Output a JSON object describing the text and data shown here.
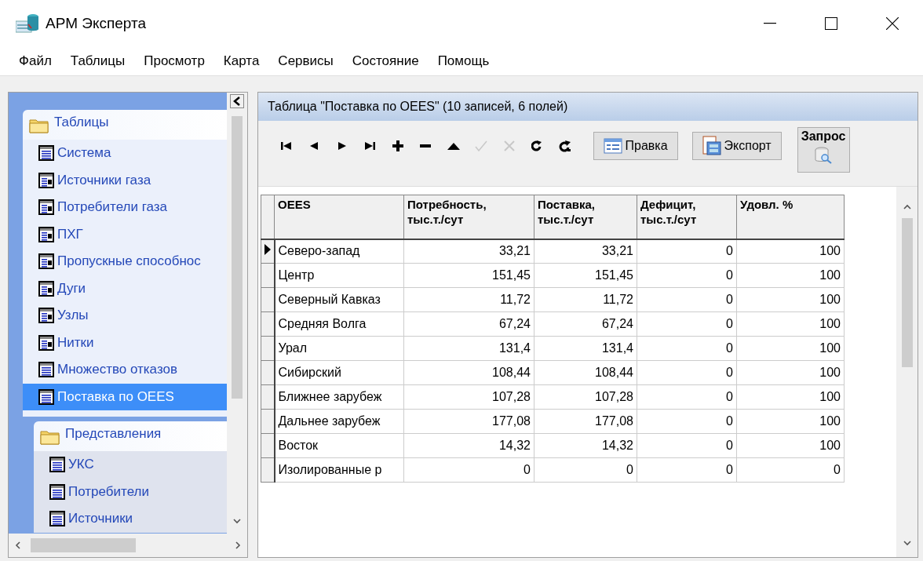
{
  "window": {
    "title": "АРМ Эксперта"
  },
  "menu": [
    "Файл",
    "Таблицы",
    "Просмотр",
    "Карта",
    "Сервисы",
    "Состояние",
    "Помощь"
  ],
  "sidebar": {
    "groups": [
      {
        "title": "Таблицы",
        "items": [
          {
            "label": "Система",
            "selected": false
          },
          {
            "label": "Источники газа",
            "selected": false
          },
          {
            "label": "Потребители газа",
            "selected": false
          },
          {
            "label": "ПХГ",
            "selected": false
          },
          {
            "label": "Пропускные способнос",
            "selected": false
          },
          {
            "label": "Дуги",
            "selected": false
          },
          {
            "label": "Узлы",
            "selected": false
          },
          {
            "label": "Нитки",
            "selected": false
          },
          {
            "label": "Множество отказов",
            "selected": false
          },
          {
            "label": "Поставка по OEES",
            "selected": true
          }
        ]
      },
      {
        "title": "Представления",
        "items": [
          {
            "label": "УКС",
            "selected": false
          },
          {
            "label": "Потребители",
            "selected": false
          },
          {
            "label": "Источники",
            "selected": false
          }
        ]
      }
    ]
  },
  "panel": {
    "title": "Таблица \"Поставка по OEES\" (10 записей, 6 полей)",
    "navigator": [
      {
        "kind": "first",
        "disabled": false
      },
      {
        "kind": "prior",
        "disabled": false
      },
      {
        "kind": "next",
        "disabled": false
      },
      {
        "kind": "last",
        "disabled": false
      },
      {
        "kind": "insert",
        "disabled": false
      },
      {
        "kind": "delete",
        "disabled": false
      },
      {
        "kind": "edit",
        "disabled": false
      },
      {
        "kind": "post",
        "disabled": true
      },
      {
        "kind": "cancel",
        "disabled": true
      },
      {
        "kind": "refresh",
        "disabled": false
      },
      {
        "kind": "apply",
        "disabled": false
      }
    ],
    "buttons": [
      {
        "kind": "edit",
        "label": "Правка"
      },
      {
        "kind": "export",
        "label": "Экспорт"
      },
      {
        "kind": "query",
        "label": "Запрос"
      }
    ]
  },
  "table": {
    "columns": [
      "OEES",
      "Потребность,\nтыс.т./сут",
      "Поставка,\nтыс.т./сут",
      "Дефицит,\nтыс.т./сут",
      "Удовл. %"
    ],
    "rows": [
      {
        "selected": true,
        "cells": [
          "Северо-запад",
          "33,21",
          "33,21",
          "0",
          "100"
        ]
      },
      {
        "selected": false,
        "cells": [
          "Центр",
          "151,45",
          "151,45",
          "0",
          "100"
        ]
      },
      {
        "selected": false,
        "cells": [
          "Северный Кавказ",
          "11,72",
          "11,72",
          "0",
          "100"
        ]
      },
      {
        "selected": false,
        "cells": [
          "Средняя Волга",
          "67,24",
          "67,24",
          "0",
          "100"
        ]
      },
      {
        "selected": false,
        "cells": [
          "Урал",
          "131,4",
          "131,4",
          "0",
          "100"
        ]
      },
      {
        "selected": false,
        "cells": [
          "Сибирский",
          "108,44",
          "108,44",
          "0",
          "100"
        ]
      },
      {
        "selected": false,
        "cells": [
          "Ближнее зарубеж",
          "107,28",
          "107,28",
          "0",
          "100"
        ]
      },
      {
        "selected": false,
        "cells": [
          "Дальнее зарубеж",
          "177,08",
          "177,08",
          "0",
          "100"
        ]
      },
      {
        "selected": false,
        "cells": [
          "Восток",
          "14,32",
          "14,32",
          "0",
          "100"
        ]
      },
      {
        "selected": false,
        "cells": [
          "Изолированные р",
          "0",
          "0",
          "0",
          "0"
        ]
      }
    ]
  }
}
